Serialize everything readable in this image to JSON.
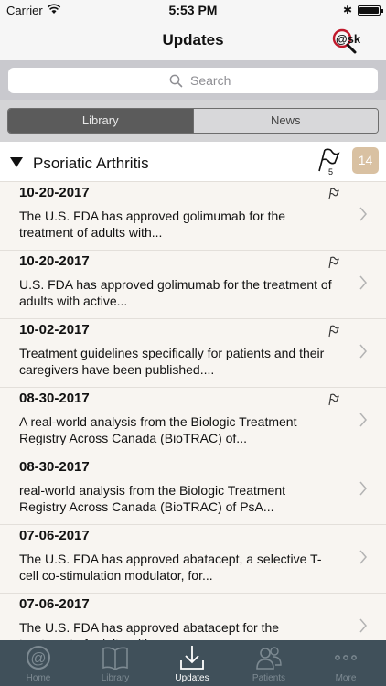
{
  "status": {
    "carrier": "Carrier",
    "time": "5:53 PM"
  },
  "nav": {
    "title": "Updates",
    "logo_text": "@sk"
  },
  "search": {
    "placeholder": "Search"
  },
  "segments": {
    "left": "Library",
    "right": "News"
  },
  "section": {
    "title": "Psoriatic Arthritis",
    "flag_count": "5",
    "badge": "14"
  },
  "items": [
    {
      "date": "10-20-2017",
      "text": "The U.S. FDA has approved golimumab for the treatment of adults with..."
    },
    {
      "date": "10-20-2017",
      "text": "U.S. FDA has approved golimumab for the treatment of adults with active..."
    },
    {
      "date": "10-02-2017",
      "text": "Treatment guidelines specifically for patients and their caregivers have been published...."
    },
    {
      "date": "08-30-2017",
      "text": "A real-world analysis from the Biologic Treatment Registry Across Canada (BioTRAC) of..."
    },
    {
      "date": "08-30-2017",
      "text": "real-world analysis from the Biologic Treatment Registry Across Canada (BioTRAC) of PsA..."
    },
    {
      "date": "07-06-2017",
      "text": "The U.S. FDA has approved abatacept, a selective T-cell co-stimulation modulator, for..."
    },
    {
      "date": "07-06-2017",
      "text": "The U.S. FDA has approved abatacept for the treatment of adults with..."
    }
  ],
  "tabs": [
    {
      "label": "Home",
      "icon": "at-sign-icon"
    },
    {
      "label": "Library",
      "icon": "book-icon"
    },
    {
      "label": "Updates",
      "icon": "download-icon"
    },
    {
      "label": "Patients",
      "icon": "people-icon"
    },
    {
      "label": "More",
      "icon": "ellipsis-icon"
    }
  ],
  "colors": {
    "tab_bar": "#40505a",
    "badge": "#d9c1a2",
    "search_bg": "#c9c9ce"
  }
}
